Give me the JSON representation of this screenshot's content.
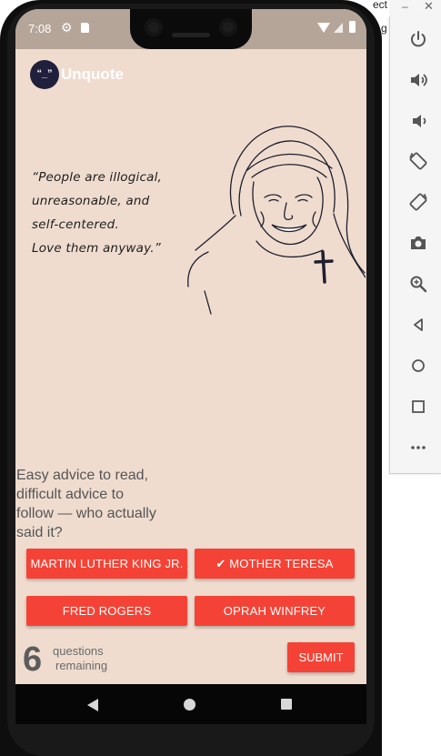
{
  "status_bar": {
    "time": "7:08"
  },
  "app": {
    "title": "Unquote",
    "logo_text": "“_”"
  },
  "quote": {
    "lines": [
      "“People are illogical,",
      "unreasonable, and",
      "self-centered.",
      "Love them anyway.”"
    ]
  },
  "question": {
    "lines": [
      "Easy advice to read,",
      "difficult advice to",
      "follow — who actually",
      " said it?"
    ]
  },
  "answers": [
    {
      "label": "Martin Luther King Jr."
    },
    {
      "label": "✔ Mother Teresa",
      "selected": true
    },
    {
      "label": "Fred Rogers"
    },
    {
      "label": "Oprah Winfrey"
    }
  ],
  "remaining": {
    "count": "6",
    "line1": "questions",
    "line2": "remaining"
  },
  "submit_label": "Submit",
  "emulator": {
    "clipped_text_top": "ect",
    "clipped_text_2": "g",
    "icons": [
      "power-icon",
      "volume-up-icon",
      "volume-down-icon",
      "rotate-left-icon",
      "rotate-right-icon",
      "camera-icon",
      "zoom-icon",
      "back-icon",
      "home-icon",
      "overview-icon",
      "more-icon"
    ]
  },
  "colors": {
    "accent": "#f44336",
    "background": "#efdccf",
    "logo_bg": "#20203c"
  }
}
